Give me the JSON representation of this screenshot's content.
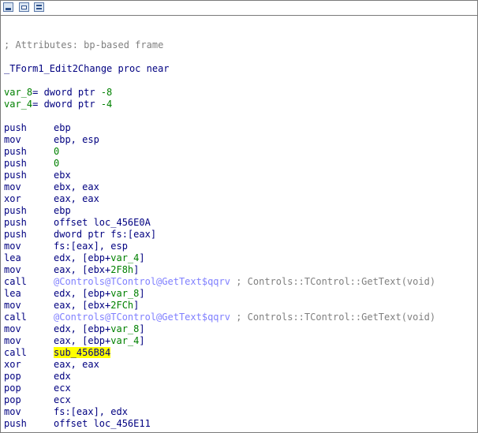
{
  "toolbar": {
    "icons": [
      "graph-view-icon",
      "flowchart-icon",
      "text-view-icon"
    ]
  },
  "listing": {
    "comment_header": "; Attributes: bp-based frame",
    "proc_header": "_TForm1_Edit2Change proc near",
    "var8_name": "var_8",
    "var8_def": "= dword ptr ",
    "var8_val": "-8",
    "var4_name": "var_4",
    "var4_def": "= dword ptr ",
    "var4_val": "-4",
    "instructions": [
      {
        "mn": "push",
        "op": "ebp"
      },
      {
        "mn": "mov",
        "op": "ebp, esp"
      },
      {
        "mn": "push",
        "num": "0"
      },
      {
        "mn": "push",
        "num": "0"
      },
      {
        "mn": "push",
        "op": "ebx"
      },
      {
        "mn": "mov",
        "op": "ebx, eax"
      },
      {
        "mn": "xor",
        "op": "eax, eax"
      },
      {
        "mn": "push",
        "op": "ebp"
      },
      {
        "mn": "push",
        "op": "offset loc_456E0A"
      },
      {
        "mn": "push",
        "op": "dword ptr fs:[eax]"
      },
      {
        "mn": "mov",
        "op": "fs:[eax], esp"
      },
      {
        "mn": "lea",
        "pre": "edx, [ebp+",
        "var": "var_4",
        "post": "]"
      },
      {
        "mn": "mov",
        "pre": "eax, [ebx+",
        "num": "2F8h",
        "post": "]"
      },
      {
        "mn": "call",
        "ext": "@Controls@TControl@GetText$qqrv",
        "comment": " ; Controls::TControl::GetText(void)"
      },
      {
        "mn": "lea",
        "pre": "edx, [ebp+",
        "var": "var_8",
        "post": "]"
      },
      {
        "mn": "mov",
        "pre": "eax, [ebx+",
        "num": "2FCh",
        "post": "]"
      },
      {
        "mn": "call",
        "ext": "@Controls@TControl@GetText$qqrv",
        "comment": " ; Controls::TControl::GetText(void)"
      },
      {
        "mn": "mov",
        "pre": "edx, [ebp+",
        "var": "var_8",
        "post": "]"
      },
      {
        "mn": "mov",
        "pre": "eax, [ebp+",
        "var": "var_4",
        "post": "]"
      },
      {
        "mn": "call",
        "sub": "sub_456B84"
      },
      {
        "mn": "xor",
        "op": "eax, eax"
      },
      {
        "mn": "pop",
        "op": "edx"
      },
      {
        "mn": "pop",
        "op": "ecx"
      },
      {
        "mn": "pop",
        "op": "ecx"
      },
      {
        "mn": "mov",
        "op": "fs:[eax], edx"
      },
      {
        "mn": "push",
        "op": "offset loc_456E11"
      }
    ]
  },
  "colors": {
    "code": "#000080",
    "number": "#008000",
    "external": "#8080ff",
    "comment": "#808080",
    "highlight": "#ffff00"
  }
}
